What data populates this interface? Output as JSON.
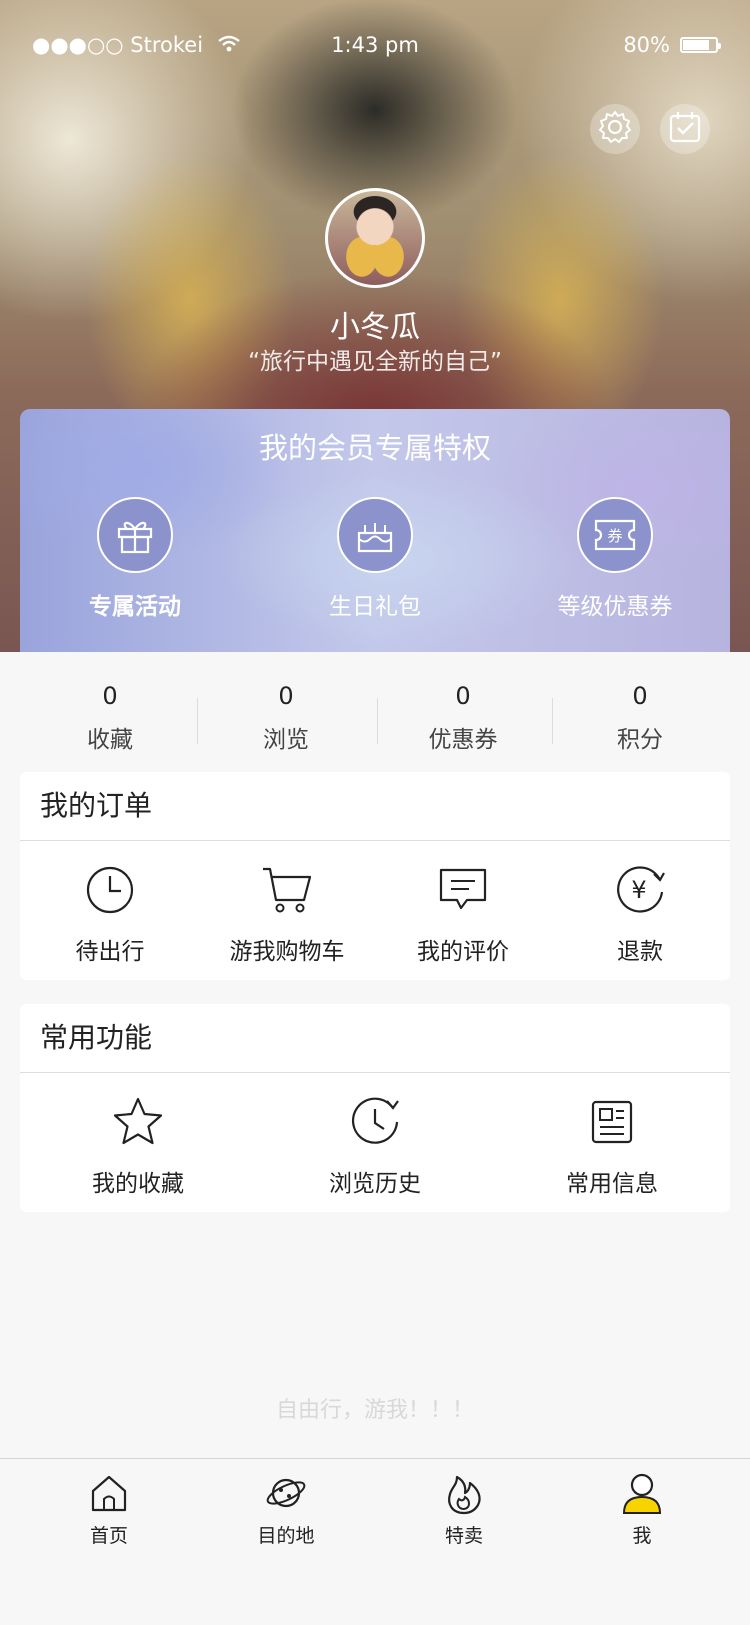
{
  "status_bar": {
    "carrier": "●●●○○ Strokei",
    "time": "1:43 pm",
    "battery": "80%",
    "battery_level": 0.8
  },
  "profile": {
    "name": "小冬瓜",
    "motto": "“旅行中遇见全新的自己”"
  },
  "vip": {
    "title": "我的会员专属特权",
    "items": [
      {
        "label": "专属活动",
        "icon": "gift-icon"
      },
      {
        "label": "生日礼包",
        "icon": "cake-icon"
      },
      {
        "label": "等级优惠券",
        "icon": "coupon-icon",
        "icon_text": "券"
      }
    ]
  },
  "stats": [
    {
      "value": "0",
      "label": "收藏"
    },
    {
      "value": "0",
      "label": "浏览"
    },
    {
      "value": "0",
      "label": "优惠券"
    },
    {
      "value": "0",
      "label": "积分"
    }
  ],
  "orders": {
    "title": "我的订单",
    "items": [
      {
        "label": "待出行",
        "icon": "clock-icon"
      },
      {
        "label": "游我购物车",
        "icon": "cart-icon"
      },
      {
        "label": "我的评价",
        "icon": "comment-icon"
      },
      {
        "label": "退款",
        "icon": "refund-icon",
        "icon_text": "¥"
      }
    ]
  },
  "functions": {
    "title": "常用功能",
    "items": [
      {
        "label": "我的收藏",
        "icon": "star-icon"
      },
      {
        "label": "浏览历史",
        "icon": "history-icon"
      },
      {
        "label": "常用信息",
        "icon": "info-icon"
      }
    ]
  },
  "slogan": "自由行，游我！！！",
  "tabbar": [
    {
      "label": "首页",
      "icon": "home-icon"
    },
    {
      "label": "目的地",
      "icon": "planet-icon"
    },
    {
      "label": "特卖",
      "icon": "flame-icon"
    },
    {
      "label": "我",
      "icon": "user-icon",
      "active": true
    }
  ],
  "colors": {
    "accent": "#f7d400",
    "vip_circle": "#8c93cc",
    "background": "#f7f7f7"
  }
}
